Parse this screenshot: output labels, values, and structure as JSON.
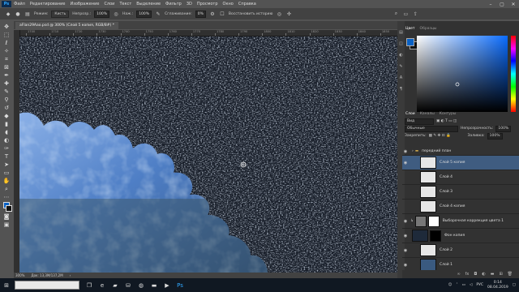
{
  "menubar": {
    "logo": "Ps",
    "items": [
      "Файл",
      "Редактирование",
      "Изображение",
      "Слои",
      "Текст",
      "Выделение",
      "Фильтр",
      "3D",
      "Просмотр",
      "Окно",
      "Справка"
    ]
  },
  "options": {
    "mode_label": "Режим:",
    "mode_value": "Кисть",
    "opacity_label": "Непрозр.:",
    "opacity_value": "100%",
    "pressure_label": "Наж.:",
    "pressure_value": "100%",
    "smoothing_label": "Сглаживание:",
    "smoothing_value": "0%",
    "restore_label": "Восстановить историю"
  },
  "document": {
    "tab_title": "aFlan29Aao.psd @ 300% (Слой 5 копия, RGB/8#) *",
    "ruler_numbers": [
      "1700",
      "1710",
      "1720",
      "1730",
      "1740",
      "1750",
      "1760",
      "1770",
      "1780",
      "1790",
      "1800",
      "1810",
      "1820",
      "1830",
      "1840",
      "1850"
    ],
    "zoom": "300%",
    "doc_info": "Док: 13,3М/137,2М"
  },
  "color_panel": {
    "tabs": [
      "Цвет",
      "Образцы"
    ],
    "fg_color": "#0a61c4",
    "bg_color": "#111111"
  },
  "layers_panel": {
    "tabs": [
      "Слои",
      "Каналы",
      "Контуры"
    ],
    "filter_value": "Вид",
    "blend_mode": "Обычные",
    "opacity_label": "Непрозрачность:",
    "opacity_value": "100%",
    "lock_label": "Закрепить:",
    "fill_label": "Заливка:",
    "fill_value": "100%",
    "layers": [
      {
        "name": "передний план",
        "kind": "group"
      },
      {
        "name": "Слой 5 копия",
        "kind": "layer",
        "selected": true
      },
      {
        "name": "Слой 4",
        "kind": "layer"
      },
      {
        "name": "Слой 3",
        "kind": "layer"
      },
      {
        "name": "Слой 4 копия",
        "kind": "layer"
      },
      {
        "name": "Выборочная коррекция цвета 1",
        "kind": "adjustment"
      },
      {
        "name": "Фон копия",
        "kind": "photo"
      },
      {
        "name": "Слой 2",
        "kind": "layer"
      },
      {
        "name": "Слой 1",
        "kind": "photo"
      }
    ]
  },
  "taskbar": {
    "search_placeholder": "",
    "lang": "РУС",
    "time": "0:14",
    "date": "08.04.2019"
  }
}
